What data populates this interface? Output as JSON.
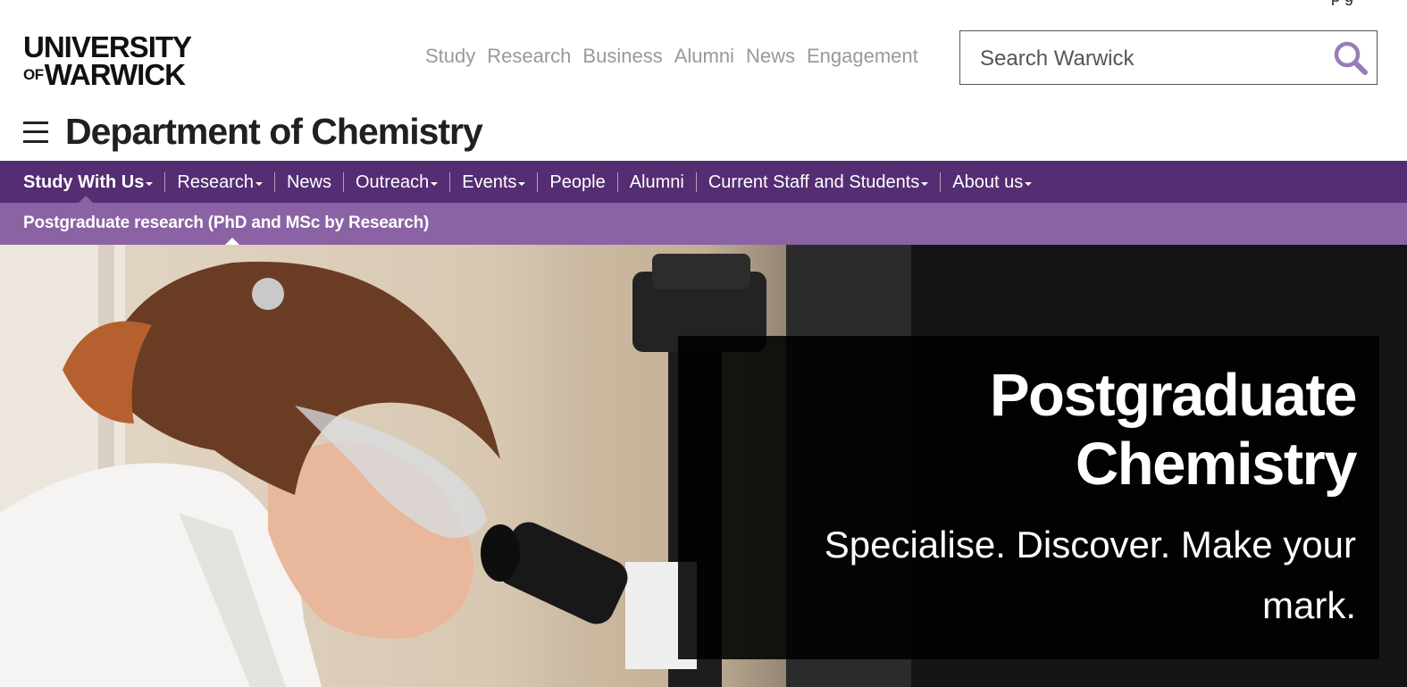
{
  "header": {
    "logo_line1": "UNIVERSITY",
    "logo_of": "OF",
    "logo_line2": "WARWICK",
    "global_nav": [
      "Study",
      "Research",
      "Business",
      "Alumni",
      "News",
      "Engagement"
    ],
    "search": {
      "placeholder": "Search Warwick",
      "value": ""
    },
    "top_right_partial": "p          g"
  },
  "department": {
    "title": "Department of Chemistry"
  },
  "primary_nav": [
    {
      "label": "Study With Us",
      "dropdown": true,
      "active": true
    },
    {
      "label": "Research",
      "dropdown": true
    },
    {
      "label": "News",
      "dropdown": false
    },
    {
      "label": "Outreach",
      "dropdown": true
    },
    {
      "label": "Events",
      "dropdown": true
    },
    {
      "label": "People",
      "dropdown": false
    },
    {
      "label": "Alumni",
      "dropdown": false
    },
    {
      "label": "Current Staff and Students",
      "dropdown": true
    },
    {
      "label": "About us",
      "dropdown": true
    }
  ],
  "secondary_nav": {
    "label": "Postgraduate research (PhD and MSc by Research)"
  },
  "hero": {
    "title_line1": "Postgraduate",
    "title_line2": "Chemistry",
    "subtitle": "Specialise. Discover. Make your mark.",
    "image_alt": "Researcher in lab coat and safety goggles looking through a microscope"
  },
  "colors": {
    "brand_purple": "#552d73",
    "secondary_purple": "#8b63a4",
    "search_icon": "#9a7bb8"
  },
  "icons": {
    "menu": "hamburger-icon",
    "search": "search-icon",
    "dropdown": "caret-down-icon"
  }
}
